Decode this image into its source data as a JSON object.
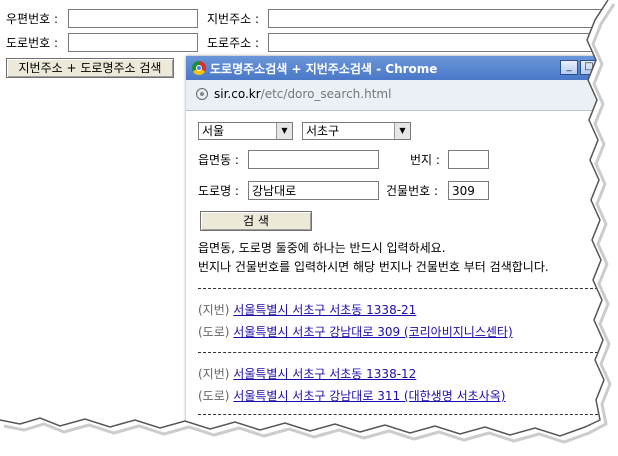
{
  "form": {
    "postal_label": "우편번호 :",
    "jibun_label": "지번주소 :",
    "road_num_label": "도로번호 :",
    "road_addr_label": "도로주소 :",
    "search_button": "지번주소 + 도로명주소 검색"
  },
  "popup": {
    "title": "도로명주소검색 + 지번주소검색 - Chrome",
    "address_domain": "sir.co.kr",
    "address_path": "/etc/doro_search.html",
    "city_select": "서울",
    "district_select": "서초구",
    "eup_label": "읍면동 :",
    "eup_value": "",
    "bunji_label": "번지 :",
    "bunji_value": "",
    "road_label": "도로명 :",
    "road_value": "강남대로",
    "building_label": "건물번호 :",
    "building_value": "309",
    "search_button": "검 색",
    "help_line1": "읍면동, 도로명 둘중에 하나는 반드시 입력하세요.",
    "help_line2": "번지나 건물번호를 입력하시면 해당 번지나 건물번호 부터 검색합니다.",
    "results": [
      {
        "tag": "(지번)",
        "text": "서울특별시 서초구 서초동 1338-21"
      },
      {
        "tag": "(도로)",
        "text": "서울특별시 서초구 강남대로 309 (코리아비지니스센타)"
      },
      {
        "tag": "(지번)",
        "text": "서울특별시 서초구 서초동 1338-12"
      },
      {
        "tag": "(도로)",
        "text": "서울특별시 서초구 강남대로 311 (대한생명 서초사옥)"
      }
    ]
  },
  "colors": {
    "titlebar": "#4a78c8",
    "link": "#1a0dab"
  }
}
